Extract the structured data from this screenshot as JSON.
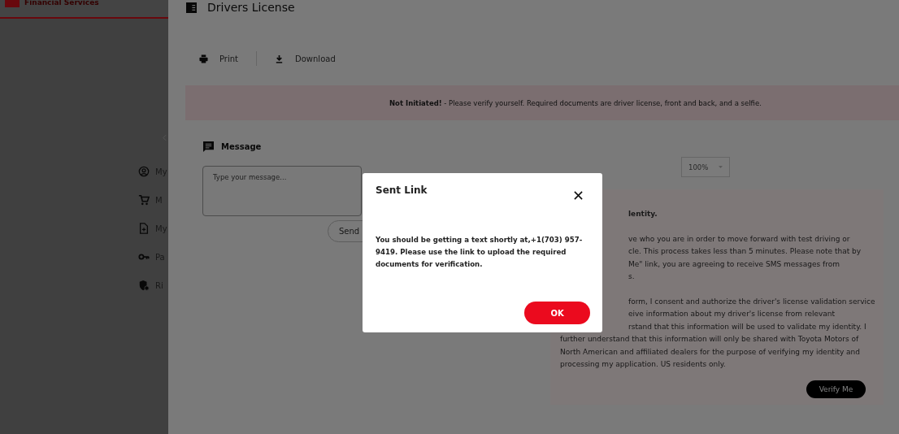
{
  "sidebar": {
    "brand": "Financial Services",
    "items": [
      {
        "label": "My"
      },
      {
        "label": "M"
      },
      {
        "label": "My"
      },
      {
        "label": "Pa"
      },
      {
        "label": "Ri"
      }
    ]
  },
  "page": {
    "title": "Drivers License",
    "toolbar": [
      {
        "label": "Print"
      },
      {
        "label": "Download"
      }
    ],
    "banner": {
      "text": "**Not Initiated!** - Please verify yourself. Required documents are driver license, front and back, and a selfie."
    },
    "message": {
      "heading": "Message",
      "placeholder": "Type your message...",
      "send": "Send"
    },
    "zoom": {
      "value": "100%"
    },
    "consent": {
      "paragraphs": [
        [
          {
            "kind": "cut",
            "text": "lentity."
          }
        ],
        [
          {
            "kind": "cut",
            "text": "ve who you are in order to move forward with test driving or"
          },
          {
            "kind": "cut",
            "text": "cle. This process takes less than 5 minutes. Please note that by"
          },
          {
            "kind": "cut",
            "text": "Me\" link, you are agreeing to receive SMS messages from"
          },
          {
            "kind": "cut",
            "text": "s."
          }
        ],
        [
          {
            "kind": "cut",
            "text": "form, I consent and authorize the driver's license validation service"
          },
          {
            "kind": "cut",
            "text": "eive information about my driver's license from relevant"
          },
          {
            "kind": "cut",
            "text": "rstand that this information will be used to validate my identity. I"
          },
          {
            "kind": "full",
            "text": "further understand that this information will only be shared with Toyota Motors of"
          },
          {
            "kind": "full",
            "text": "North American and affiliated dealers for the purpose of verifying my identity and"
          },
          {
            "kind": "full",
            "text": "processing my application. US residents only."
          }
        ]
      ],
      "button": "Verify Me"
    }
  },
  "dialog": {
    "title": "Sent Link",
    "body": "You should be getting a text shortly at,+1(703) 957-9419. Please use the link to upload the required documents for verification.",
    "ok": "OK"
  }
}
